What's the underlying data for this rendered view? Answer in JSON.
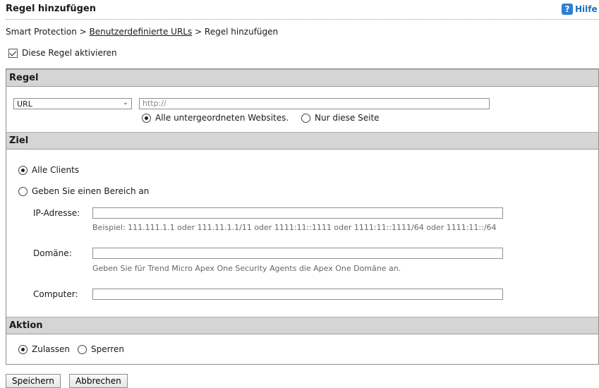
{
  "header": {
    "title": "Regel hinzufügen",
    "help_label": "Hilfe"
  },
  "breadcrumb": {
    "part1": "Smart Protection",
    "sep1": " > ",
    "link": "Benutzerdefinierte URLs",
    "sep2": " > ",
    "current": "Regel hinzufügen"
  },
  "enable_rule": {
    "label": "Diese Regel aktivieren",
    "checked": true
  },
  "rule_section": {
    "heading": "Regel",
    "type_selected": "URL",
    "url_placeholder": "http://",
    "scope_options": [
      {
        "label": "Alle untergeordneten Websites.",
        "selected": true
      },
      {
        "label": "Nur diese Seite",
        "selected": false
      }
    ]
  },
  "target_section": {
    "heading": "Ziel",
    "all_clients": "Alle Clients",
    "specify_range": "Geben Sie einen Bereich an",
    "ip_label": "IP-Adresse:",
    "ip_hint": "Beispiel: 111.111.1.1 oder 111.11.1.1/11 oder 1111:11::1111 oder 1111:11::1111/64 oder 1111:11::/64",
    "domain_label": "Domäne:",
    "domain_hint": "Geben Sie für Trend Micro Apex One Security Agents die Apex One Domäne an.",
    "computer_label": "Computer:"
  },
  "action_section": {
    "heading": "Aktion",
    "allow": "Zulassen",
    "block": "Sperren"
  },
  "buttons": {
    "save": "Speichern",
    "cancel": "Abbrechen"
  }
}
